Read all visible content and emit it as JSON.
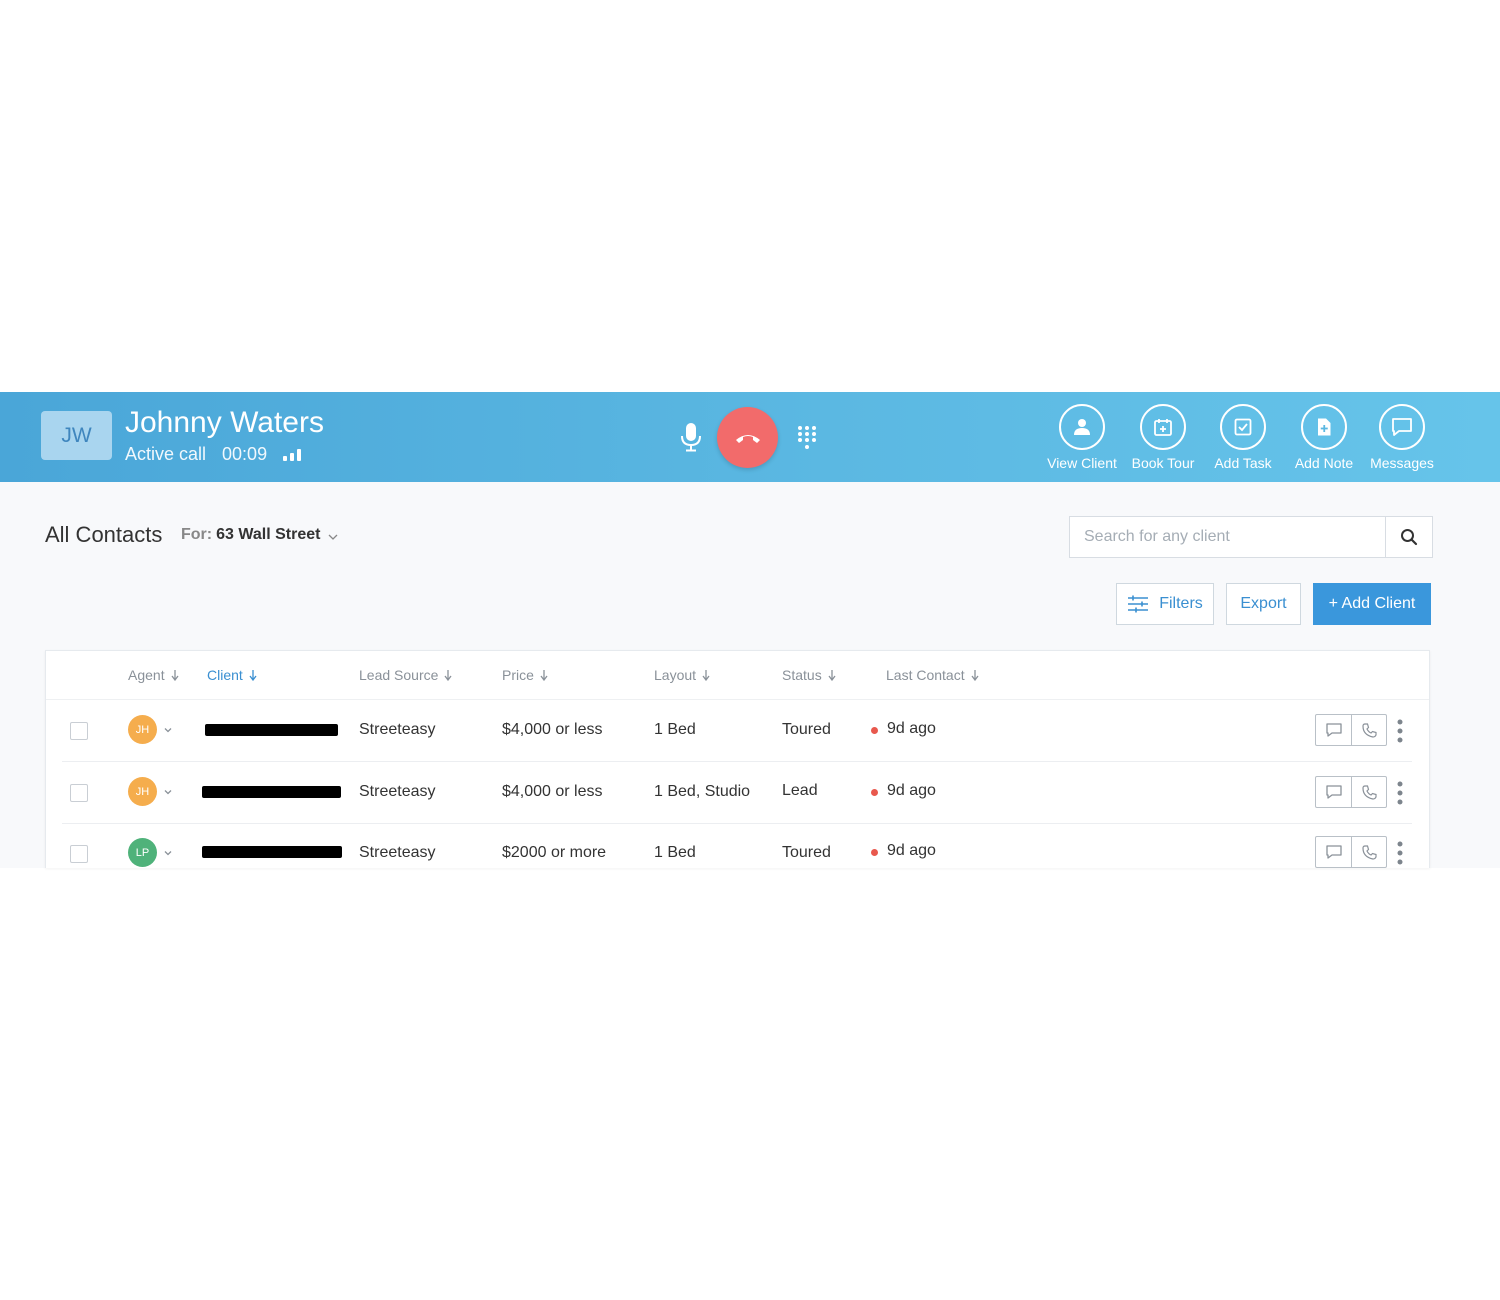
{
  "call": {
    "initials": "JW",
    "name": "Johnny Waters",
    "status": "Active call",
    "duration": "00:09",
    "actions": [
      {
        "label": "View Client",
        "icon": "user-icon"
      },
      {
        "label": "Book Tour",
        "icon": "calendar-add-icon"
      },
      {
        "label": "Add Task",
        "icon": "task-check-icon"
      },
      {
        "label": "Add Note",
        "icon": "note-add-icon"
      },
      {
        "label": "Messages",
        "icon": "message-icon"
      }
    ]
  },
  "page": {
    "title": "All Contacts",
    "for_label": "For:",
    "for_value": "63 Wall Street"
  },
  "search": {
    "placeholder": "Search for any client"
  },
  "toolbar": {
    "filters": "Filters",
    "export": "Export",
    "add_client": "+ Add Client"
  },
  "colors": {
    "accent": "#3a97dc",
    "hangup": "#f26b6b",
    "status_dot": "#e8584d",
    "agent_jh": "#f5ad4d",
    "agent_lp": "#4fb27a"
  },
  "table": {
    "columns": [
      "Agent",
      "Client",
      "Lead Source",
      "Price",
      "Layout",
      "Status",
      "Last Contact"
    ],
    "rows": [
      {
        "agent": "JH",
        "source": "Streeteasy",
        "price": "$4,000 or less",
        "layout": "1 Bed",
        "status": "Toured",
        "last_contact": "9d ago"
      },
      {
        "agent": "JH",
        "source": "Streeteasy",
        "price": "$4,000 or less",
        "layout": "1 Bed, Studio",
        "status": "Lead",
        "last_contact": "9d ago"
      },
      {
        "agent": "LP",
        "source": "Streeteasy",
        "price": "$2000 or more",
        "layout": "1 Bed",
        "status": "Toured",
        "last_contact": "9d ago"
      }
    ]
  }
}
